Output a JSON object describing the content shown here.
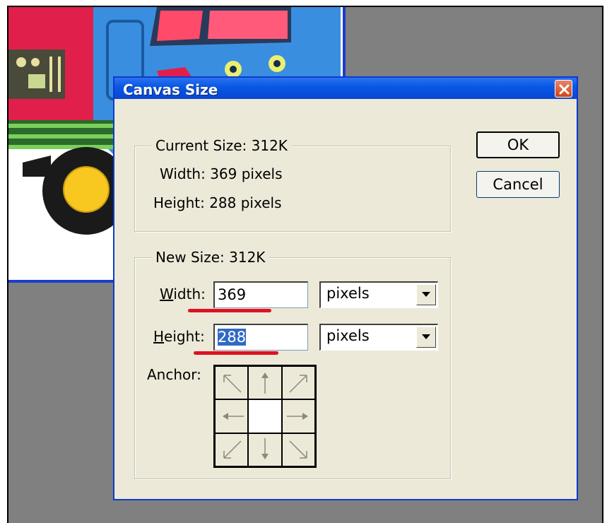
{
  "dialog": {
    "title": "Canvas Size",
    "current_size": {
      "legend": "Current Size:  312K",
      "width_text": "Width:  369 pixels",
      "height_text": "Height:  288 pixels"
    },
    "new_size": {
      "legend": "New Size:  312K",
      "width_label_underlined": "W",
      "width_label_rest": "idth:",
      "width_value": "369",
      "width_unit": "pixels",
      "height_label_underlined": "H",
      "height_label_rest": "eight:",
      "height_value": "288",
      "height_unit": "pixels",
      "anchor_label": "Anchor:",
      "anchor_selected": "center"
    },
    "buttons": {
      "ok": "OK",
      "cancel": "Cancel"
    }
  },
  "colors": {
    "title_bar": "#0a58e5",
    "dialog_bg": "#ece9d8",
    "workspace": "#808080",
    "annotation_underline": "#dd1222",
    "selection": "#316ac5"
  },
  "icons": [
    "close-icon",
    "dropdown-arrow-icon",
    "anchor-arrow-icon"
  ]
}
